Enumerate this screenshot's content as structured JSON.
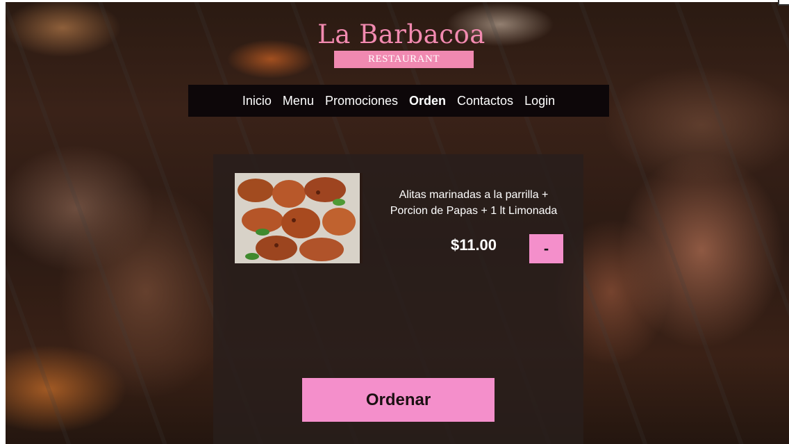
{
  "brand": {
    "title": "La Barbacoa",
    "subtitle": "RESTAURANT"
  },
  "nav": {
    "items": [
      {
        "label": "Inicio"
      },
      {
        "label": "Menu"
      },
      {
        "label": "Promociones"
      },
      {
        "label": "Orden"
      },
      {
        "label": "Contactos"
      },
      {
        "label": "Login"
      }
    ],
    "active": "Orden"
  },
  "order": {
    "item_description": "Alitas marinadas a la parrilla + Porcion de Papas + 1 lt Limonada",
    "price": "$11.00",
    "remove_label": "-",
    "order_button_label": "Ordenar",
    "image_icon": "grilled-chicken-wings-image"
  },
  "colors": {
    "accent": "#f48fcb",
    "brand": "#f28ab0",
    "nav_bg": "#0d0709"
  }
}
